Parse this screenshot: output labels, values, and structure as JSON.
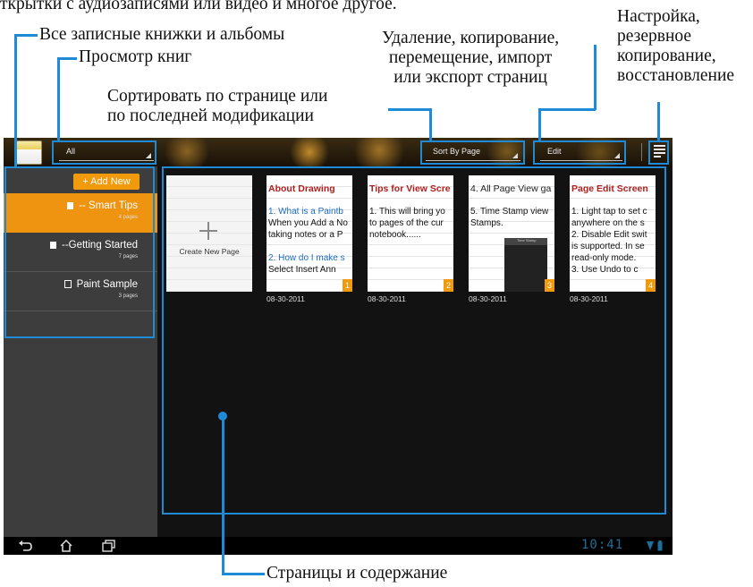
{
  "annotations": {
    "top_partial": "ткрытки с аудиозаписями или видео и многое другое.",
    "all_notebooks": "Все записные книжки и альбомы",
    "book_view": "Просмотр книг",
    "page_ops": [
      "Удаление, копирование,",
      "перемещение, импорт",
      "или экспорт страниц"
    ],
    "sort": [
      "Сортировать по странице или",
      "по последней модификации"
    ],
    "settings": [
      "Настройка,",
      "резервное",
      "копирование,",
      "восстановление"
    ],
    "pages_content": "Страницы и содержание"
  },
  "topbar": {
    "view_spinner": "All",
    "sort_spinner": "Sort By Page",
    "edit_spinner": "Edit",
    "menu_icon": "menu-icon"
  },
  "sidebar": {
    "add_new": "+ Add New",
    "notebooks": [
      {
        "title": "-- Smart Tips",
        "count": "4 pages",
        "selected": true
      },
      {
        "title": "--Getting Started",
        "count": "7 pages",
        "selected": false
      },
      {
        "title": "Paint Sample",
        "count": "3 pages",
        "selected": false
      }
    ]
  },
  "main": {
    "create_label": "Create New Page",
    "pages": [
      {
        "title": "About Drawing",
        "lines": [
          "1. What is a Paintb",
          "When you Add a No",
          "taking notes or a P",
          "2. How do I make s",
          "Select Insert Ann"
        ],
        "number": "1",
        "date": "08-30-2011"
      },
      {
        "title": "Tips for View Scre",
        "lines": [
          "1. This will bring yo",
          "to pages of the cur",
          "notebook......"
        ],
        "number": "2",
        "date": "08-30-2011"
      },
      {
        "title": "4. All Page View ga",
        "lines": [
          "5. Time Stamp view",
          "Stamps."
        ],
        "thumb_text": "Time Stamp",
        "number": "3",
        "date": "08-30-2011"
      },
      {
        "title": "Page Edit Screen",
        "lines": [
          "1. Light tap to set c",
          "anywhere on the s",
          "2. Disable Edit swit",
          "is supported. In se",
          "read-only mode.",
          "3. Use Undo to c"
        ],
        "number": "4",
        "date": "08-30-2011"
      }
    ]
  },
  "status": {
    "time": "10:41"
  },
  "colors": {
    "accent": "#1f8bd6",
    "orange": "#f19a0c",
    "title_red": "#b01e1e"
  }
}
